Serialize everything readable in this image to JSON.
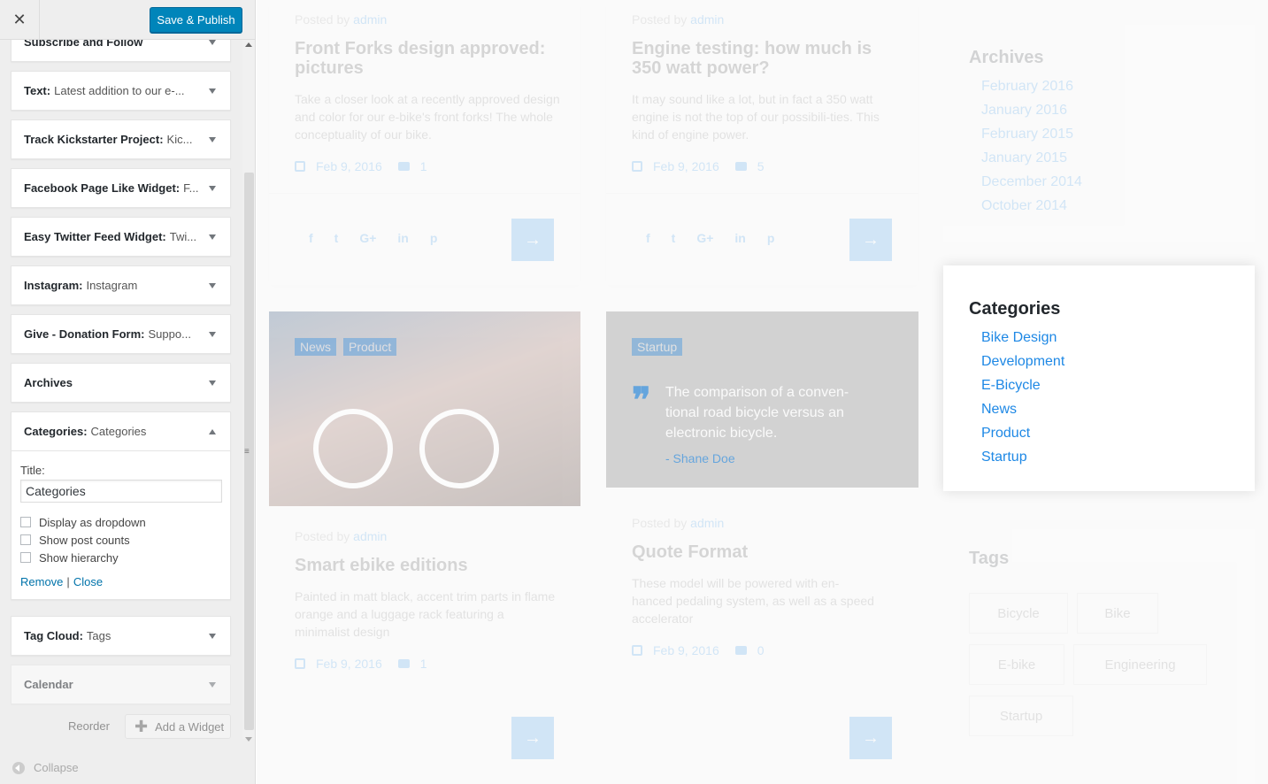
{
  "header": {
    "close_label": "✕",
    "publish_label": "Save & Publish"
  },
  "widgets": [
    {
      "title": "Subscribe and Follow",
      "subtitle": ""
    },
    {
      "title": "Text:",
      "subtitle": "Latest addition to our e-..."
    },
    {
      "title": "Track Kickstarter Project:",
      "subtitle": "Kic..."
    },
    {
      "title": "Facebook Page Like Widget:",
      "subtitle": "F..."
    },
    {
      "title": "Easy Twitter Feed Widget:",
      "subtitle": "Twi..."
    },
    {
      "title": "Instagram:",
      "subtitle": "Instagram"
    },
    {
      "title": "Give - Donation Form:",
      "subtitle": "Suppo..."
    },
    {
      "title": "Archives",
      "subtitle": ""
    },
    {
      "title": "Categories:",
      "subtitle": "Categories"
    },
    {
      "title": "Tag Cloud:",
      "subtitle": "Tags"
    },
    {
      "title": "Calendar",
      "subtitle": ""
    }
  ],
  "categories_form": {
    "title_label": "Title:",
    "title_value": "Categories",
    "options": [
      "Display as dropdown",
      "Show post counts",
      "Show hierarchy"
    ],
    "remove_label": "Remove",
    "separator": "|",
    "close_label": "Close"
  },
  "footer": {
    "reorder_label": "Reorder",
    "add_widget_label": "Add a Widget",
    "collapse_label": "Collapse"
  },
  "posts": [
    {
      "by": "Posted by",
      "author": "admin",
      "title": "Front Forks design approved: pictures",
      "excerpt": "Take a closer look at a recently approved design and color for our e-bike's front forks! The whole conceptuality of our bike.",
      "date": "Feb 9, 2016",
      "comments": "1"
    },
    {
      "by": "Posted by",
      "author": "admin",
      "title": "Engine testing: how much is 350 watt power?",
      "excerpt": "It may sound like a lot, but in fact a 350 watt engine is not the top of our possibili-ties. This kind of engine power.",
      "date": "Feb 9, 2016",
      "comments": "5"
    },
    {
      "by": "Posted by",
      "author": "admin",
      "title": "Smart ebike editions",
      "excerpt": "Painted in matt black, accent trim parts in flame orange and a luggage rack featuring a minimalist design",
      "date": "Feb 9, 2016",
      "comments": "1"
    },
    {
      "by": "Posted by",
      "author": "admin",
      "title": "Quote Format",
      "excerpt": "These model will be powered with en-hanced pedaling system, as well as a speed accelerator",
      "date": "Feb 9, 2016",
      "comments": "0"
    }
  ],
  "social": [
    "f",
    "t",
    "G+",
    "in",
    "p"
  ],
  "post_tags": [
    "News",
    "Product",
    "Startup"
  ],
  "quote": {
    "text": "The comparison of a conven-tional road bicycle versus an electronic bicycle.",
    "author": "- Shane Doe"
  },
  "archives": {
    "title": "Archives",
    "items": [
      "February 2016",
      "January 2016",
      "February 2015",
      "January 2015",
      "December 2014",
      "October 2014"
    ]
  },
  "categories": {
    "title": "Categories",
    "items": [
      "Bike Design",
      "Development",
      "E-Bicycle",
      "News",
      "Product",
      "Startup"
    ]
  },
  "tags": {
    "title": "Tags",
    "items": [
      "Bicycle",
      "Bike",
      "E-bike",
      "Engineering",
      "Startup"
    ]
  },
  "colors": {
    "accent": "#1e88e5",
    "publish": "#0085ba"
  }
}
